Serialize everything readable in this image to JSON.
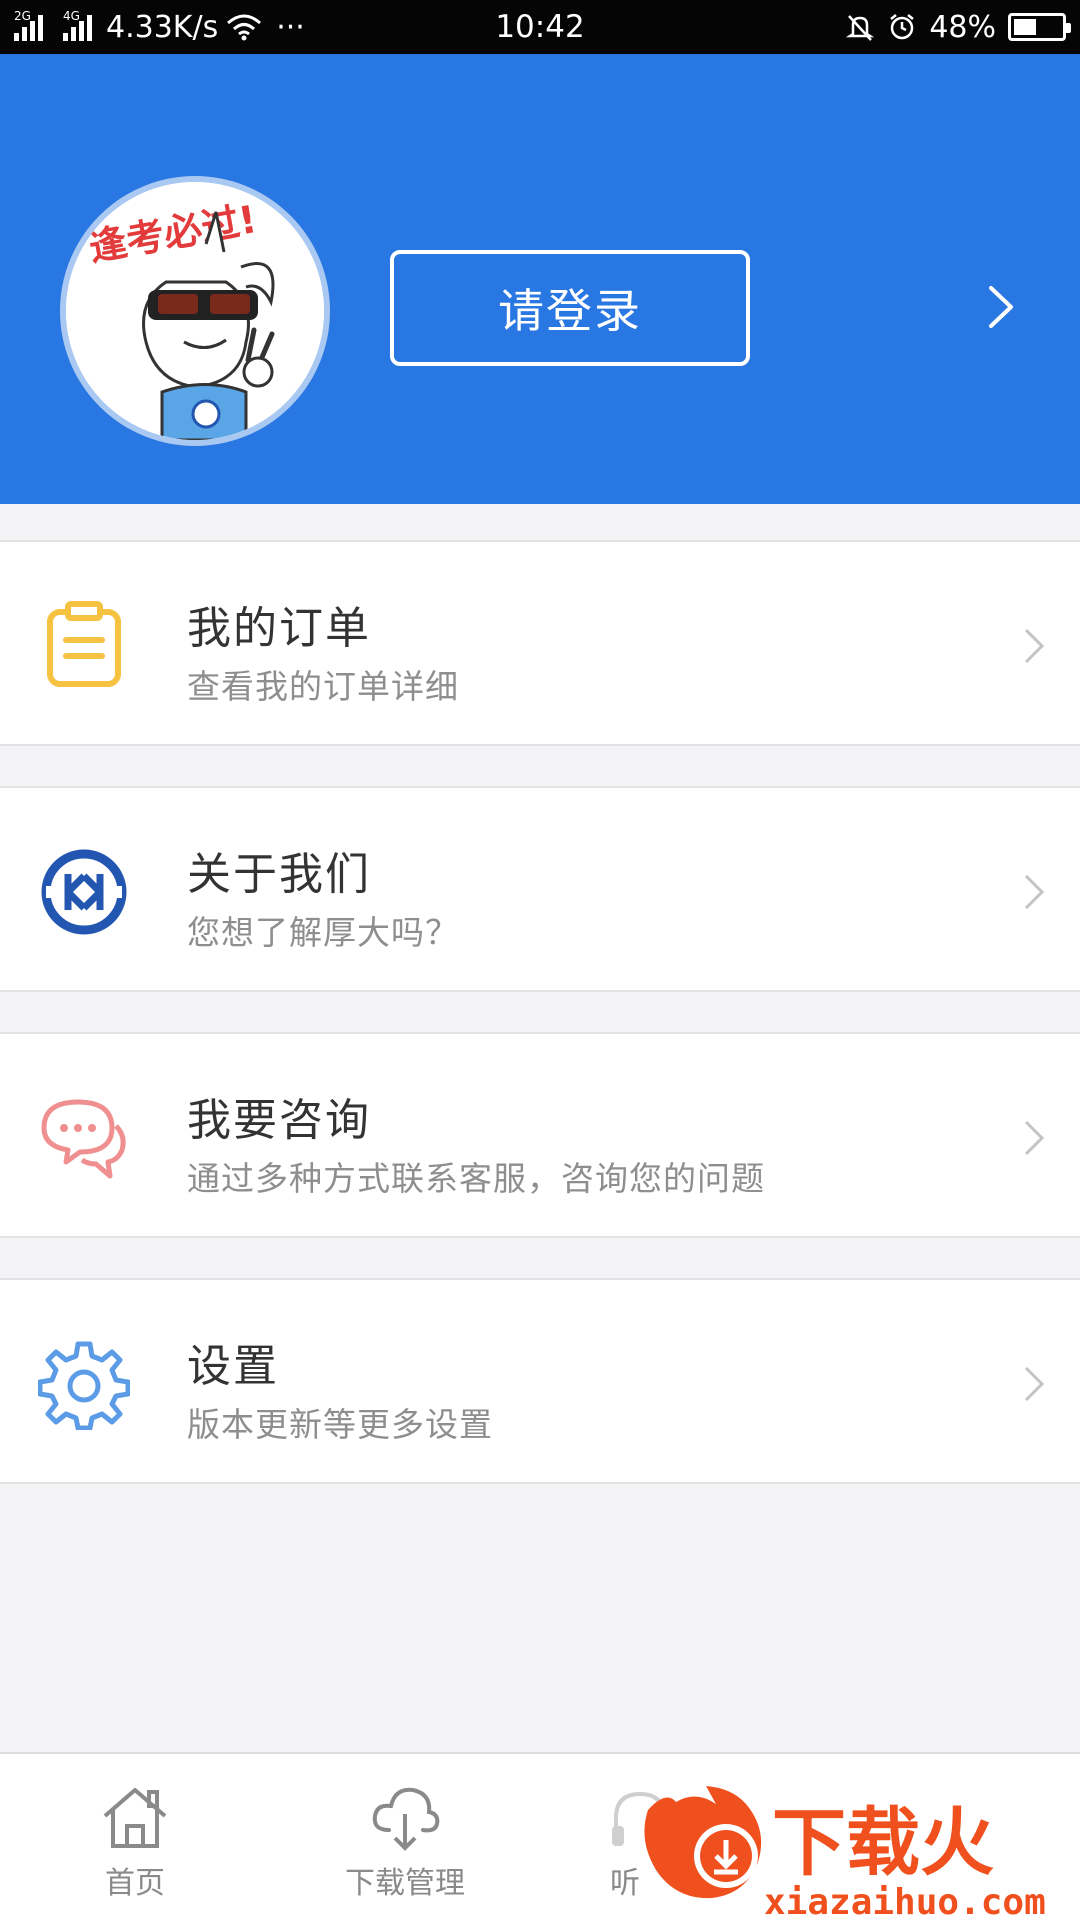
{
  "status_bar": {
    "net_2g": "2G",
    "net_4g": "4G",
    "speed": "4.33K/s",
    "more": "···",
    "time": "10:42",
    "battery": "48%",
    "battery_level": 0.48
  },
  "header": {
    "avatar_text": "逢考必过!",
    "login_label": "请登录"
  },
  "menu": [
    {
      "title": "我的订单",
      "subtitle": "查看我的订单详细",
      "icon": "clipboard-icon",
      "color": "#f5c242"
    },
    {
      "title": "关于我们",
      "subtitle": "您想了解厚大吗？",
      "icon": "houda-logo-icon",
      "color": "#2356b0"
    },
    {
      "title": "我要咨询",
      "subtitle": "通过多种方式联系客服，咨询您的问题",
      "icon": "chat-bubbles-icon",
      "color": "#ef8f8f"
    },
    {
      "title": "设置",
      "subtitle": "版本更新等更多设置",
      "icon": "gear-icon",
      "color": "#5c9be6"
    }
  ],
  "bottom_nav": [
    {
      "label": "首页",
      "icon": "home-icon"
    },
    {
      "label": "下载管理",
      "icon": "cloud-download-icon"
    },
    {
      "label": "听",
      "icon": "headphones-icon"
    }
  ],
  "watermark": {
    "title": "下载火",
    "url": "xiazaihuo.com"
  },
  "colors": {
    "brand_blue": "#2977e2",
    "background": "#f4f4f6",
    "watermark_orange": "#f0501e"
  }
}
